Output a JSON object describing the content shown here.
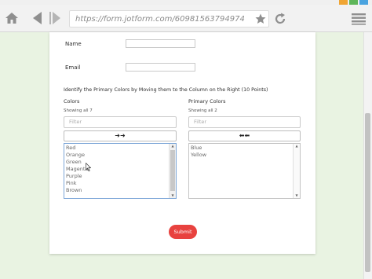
{
  "browser": {
    "url": "https://form.jotform.com/60981563794974",
    "window_button_colors": [
      "#f0a533",
      "#5fb65a",
      "#4aa3df"
    ]
  },
  "form": {
    "name_label": "Name",
    "email_label": "Email",
    "question": "Identify the Primary Colors by Moving them to the Column on the Right (10 Points)",
    "left_column": {
      "title": "Colors",
      "showing": "Showing all 7",
      "filter_placeholder": "Filter",
      "move_button": "➜➜",
      "items": [
        "Red",
        "Orange",
        "Green",
        "Magenta",
        "Purple",
        "Pink",
        "Brown"
      ]
    },
    "right_column": {
      "title": "Primary Colors",
      "showing": "Showing all 2",
      "filter_placeholder": "Filter",
      "move_button": "⬅⬅",
      "items": [
        "Blue",
        "Yellow"
      ]
    },
    "submit_label": "Submit"
  }
}
